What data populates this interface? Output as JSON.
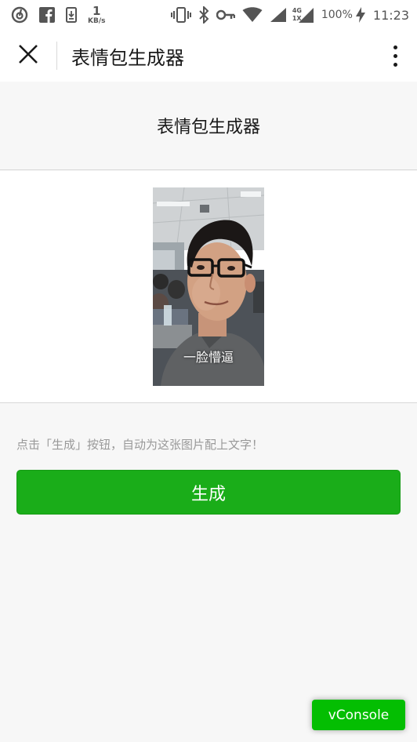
{
  "status_bar": {
    "net_speed_value": "1",
    "net_speed_unit": "KB/s",
    "network_type_top": "4G",
    "network_type_bottom": "1X",
    "battery": "100%",
    "time": "11:23",
    "icons": [
      "netease-music-icon",
      "facebook-icon",
      "download-icon",
      "vibrate-icon",
      "bluetooth-icon",
      "vpn-key-icon",
      "wifi-icon",
      "signal-icon",
      "signal-4g-icon",
      "battery-charging-icon"
    ]
  },
  "title_bar": {
    "title": "表情包生成器"
  },
  "page": {
    "title": "表情包生成器",
    "meme_caption": "一脸懵逼",
    "hint": "点击「生成」按钮，自动为这张图片配上文字！",
    "generate_label": "生成"
  },
  "vconsole": {
    "label": "vConsole"
  },
  "colors": {
    "primary_green": "#1aad19",
    "vconsole_green": "#04be02",
    "page_bg": "#f7f7f7",
    "hint_text": "#999999"
  }
}
